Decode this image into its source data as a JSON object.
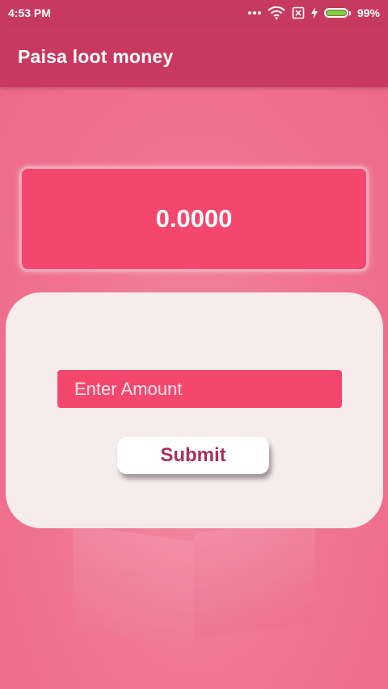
{
  "status_bar": {
    "time": "4:53 PM",
    "battery_percent": "99%",
    "battery_level": 0.99,
    "icons": [
      "more-dots-icon",
      "wifi-icon",
      "sim-disabled-icon",
      "charging-bolt-icon",
      "battery-icon"
    ]
  },
  "app_bar": {
    "title": "Paisa loot money"
  },
  "balance": {
    "value": "0.0000"
  },
  "form": {
    "amount_placeholder": "Enter Amount",
    "amount_value": "",
    "submit_label": "Submit"
  },
  "colors": {
    "status_bar": "#c73a5f",
    "app_bar": "#c9385f",
    "background": "#ef6f8c",
    "accent": "#f4476e",
    "card": "#f6ecec",
    "submit_text": "#a8315a",
    "battery_fill": "#6cdb3a"
  }
}
